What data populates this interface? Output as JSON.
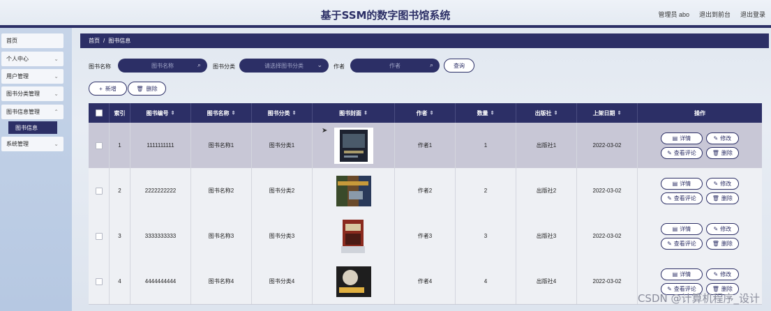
{
  "header": {
    "title": "基于SSM的数字图书馆系统",
    "admin": "管理员 abo",
    "back_front": "退出到前台",
    "logout": "退出登录"
  },
  "sidebar": {
    "items": [
      {
        "label": "首页"
      },
      {
        "label": "个人中心"
      },
      {
        "label": "用户管理"
      },
      {
        "label": "图书分类管理"
      },
      {
        "label": "图书信息管理"
      },
      {
        "label": "系统管理"
      }
    ],
    "sub_active": "图书信息"
  },
  "breadcrumb": {
    "home": "首页",
    "sep": "/",
    "current": "图书信息"
  },
  "search": {
    "name_label": "图书名称",
    "name_placeholder": "图书名称",
    "cat_label": "图书分类",
    "cat_placeholder": "请选择图书分类",
    "author_label": "作者",
    "author_placeholder": "作者",
    "query": "查询"
  },
  "actions": {
    "add": "新增",
    "delete": "删除"
  },
  "table": {
    "headers": [
      "索引",
      "图书编号",
      "图书名称",
      "图书分类",
      "图书封面",
      "作者",
      "数量",
      "出版社",
      "上架日期",
      "操作"
    ],
    "rows": [
      {
        "idx": "1",
        "no": "1111111111",
        "name": "图书名称1",
        "cat": "图书分类1",
        "author": "作者1",
        "qty": "1",
        "pub": "出版社1",
        "date": "2022-03-02"
      },
      {
        "idx": "2",
        "no": "2222222222",
        "name": "图书名称2",
        "cat": "图书分类2",
        "author": "作者2",
        "qty": "2",
        "pub": "出版社2",
        "date": "2022-03-02"
      },
      {
        "idx": "3",
        "no": "3333333333",
        "name": "图书名称3",
        "cat": "图书分类3",
        "author": "作者3",
        "qty": "3",
        "pub": "出版社3",
        "date": "2022-03-02"
      },
      {
        "idx": "4",
        "no": "4444444444",
        "name": "图书名称4",
        "cat": "图书分类4",
        "author": "作者4",
        "qty": "4",
        "pub": "出版社4",
        "date": "2022-03-02"
      }
    ],
    "ops": {
      "detail": "详情",
      "edit": "修改",
      "comments": "查看评论",
      "delete": "删除"
    }
  },
  "watermark": "CSDN @计算机程序_设计",
  "colors": {
    "accent": "#2c2f66"
  }
}
